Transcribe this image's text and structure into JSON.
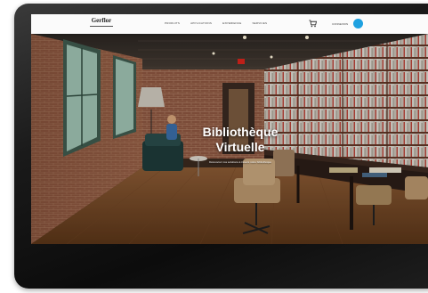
{
  "header": {
    "logo_text": "Gerflor",
    "nav_items": [
      "PRODUITS",
      "APPLICATIONS",
      "EXPERIENCE",
      "SERVICES"
    ],
    "login_label": "CONNEXION"
  },
  "hero": {
    "title_line1": "Bibliothèque",
    "title_line2": "Virtuelle",
    "subtitle": "Découvrez nos solutions à travers notre bibliothèque"
  },
  "colors": {
    "accent": "#1fa1e0",
    "bezel": "#141414",
    "navbar": "#fbfbfb"
  },
  "icons": {
    "cart": "shopping-cart-icon",
    "user": "user-avatar-icon"
  }
}
